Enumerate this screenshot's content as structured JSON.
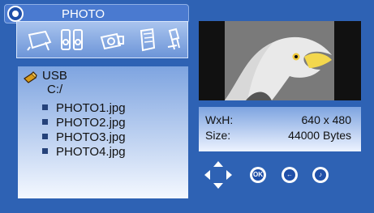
{
  "header": {
    "title": "PHOTO",
    "icon": "photo-mode-icon"
  },
  "category_icons": [
    {
      "name": "photo-frame-icon"
    },
    {
      "name": "speaker-icon"
    },
    {
      "name": "camera-icon"
    },
    {
      "name": "book-icon"
    },
    {
      "name": "usb-stick-icon"
    }
  ],
  "browser": {
    "device": "USB",
    "path": "C:/",
    "files": [
      "PHOTO1.jpg",
      "PHOTO2.jpg",
      "PHOTO3.jpg",
      "PHOTO4.jpg"
    ]
  },
  "info": {
    "size_label": "WxH:",
    "size_value": "640 x 480",
    "bytes_label": "Size:",
    "bytes_value": "44000 Bytes"
  },
  "controls": {
    "ok_label": "OK"
  },
  "colors": {
    "background": "#2e62b4",
    "panel_top": "#7ea4e0",
    "panel_bottom": "#f4f8ff",
    "accent": "#1f4fa8"
  }
}
